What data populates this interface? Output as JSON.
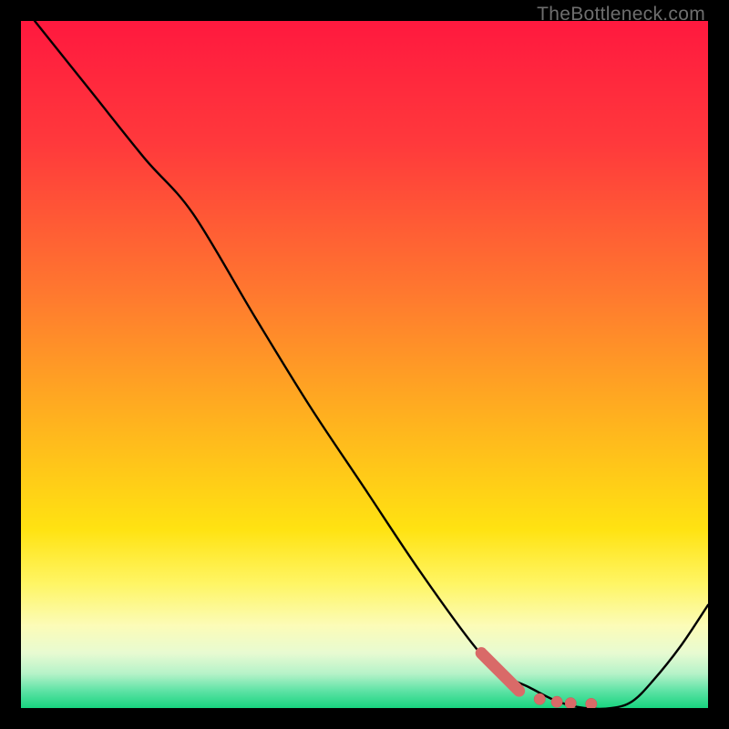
{
  "watermark": {
    "text": "TheBottleneck.com"
  },
  "colors": {
    "gradient_stops": [
      {
        "pos": 0.0,
        "color": "#ff193f"
      },
      {
        "pos": 0.18,
        "color": "#ff3a3c"
      },
      {
        "pos": 0.4,
        "color": "#ff7a2f"
      },
      {
        "pos": 0.58,
        "color": "#ffb21f"
      },
      {
        "pos": 0.74,
        "color": "#ffe312"
      },
      {
        "pos": 0.82,
        "color": "#fff666"
      },
      {
        "pos": 0.88,
        "color": "#fcfcb8"
      },
      {
        "pos": 0.92,
        "color": "#e8fbd2"
      },
      {
        "pos": 0.95,
        "color": "#b6f3c9"
      },
      {
        "pos": 0.975,
        "color": "#5ee3a6"
      },
      {
        "pos": 1.0,
        "color": "#18d47f"
      }
    ],
    "curve": "#000000",
    "marker_fill": "#d96a68",
    "marker_stroke": "#c85a58"
  },
  "chart_data": {
    "type": "line",
    "title": "",
    "xlabel": "",
    "ylabel": "",
    "xlim": [
      0,
      100
    ],
    "ylim": [
      0,
      100
    ],
    "grid": false,
    "legend": false,
    "series": [
      {
        "name": "bottleneck-curve",
        "x": [
          2,
          10,
          18,
          25,
          34,
          42,
          50,
          58,
          66,
          70,
          74,
          78,
          82,
          86,
          89,
          92,
          96,
          100
        ],
        "y": [
          100,
          90,
          80,
          72,
          57,
          44,
          32,
          20,
          9,
          5,
          3,
          1,
          0,
          0,
          1,
          4,
          9,
          15
        ]
      }
    ],
    "markers": {
      "thick_segment": {
        "x": [
          67,
          72.5
        ],
        "y": [
          8,
          2.5
        ]
      },
      "dots": [
        {
          "x": 75.5,
          "y": 1.3
        },
        {
          "x": 78,
          "y": 0.9
        },
        {
          "x": 80,
          "y": 0.7
        },
        {
          "x": 83,
          "y": 0.6
        }
      ]
    }
  }
}
